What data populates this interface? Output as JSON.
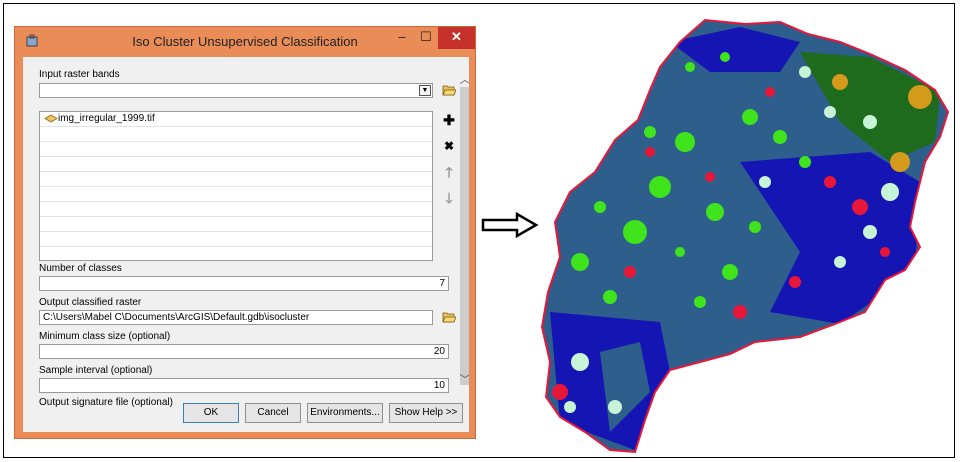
{
  "dialog": {
    "title": "Iso Cluster Unsupervised Classification",
    "min_glyph": "–",
    "max_glyph": "☐",
    "close_glyph": "✕",
    "input_raster_label": "Input raster bands",
    "input_raster_value": "",
    "raster_list": [
      "img_irregular_1999.tif"
    ],
    "num_classes_label": "Number of classes",
    "num_classes_value": "7",
    "output_raster_label": "Output classified raster",
    "output_raster_value": "C:\\Users\\Mabel C\\Documents\\ArcGIS\\Default.gdb\\isocluster",
    "min_class_size_label": "Minimum class size (optional)",
    "min_class_size_value": "20",
    "sample_interval_label": "Sample interval (optional)",
    "sample_interval_value": "10",
    "signature_file_label": "Output signature file (optional)",
    "buttons": {
      "ok": "OK",
      "cancel": "Cancel",
      "environments": "Environments...",
      "show_help": "Show Help >>"
    },
    "icons": [
      "dropdown-arrow-icon",
      "folder-open-icon",
      "raster-layer-icon",
      "add-icon",
      "remove-icon",
      "move-up-icon",
      "move-down-icon"
    ]
  },
  "colors": {
    "titlebar": "#e98c58",
    "close": "#c7312c",
    "map_blue": "#1515b4",
    "map_teal": "#2e5f8c",
    "map_green": "#3fe41c",
    "map_red": "#e8173a",
    "map_darkgreen": "#1e6b1e",
    "map_gold": "#d39a1c",
    "map_lightgreen": "#c7f3d7"
  },
  "arrow_icon": "arrow-right-icon",
  "map_image": "classified-raster-map"
}
